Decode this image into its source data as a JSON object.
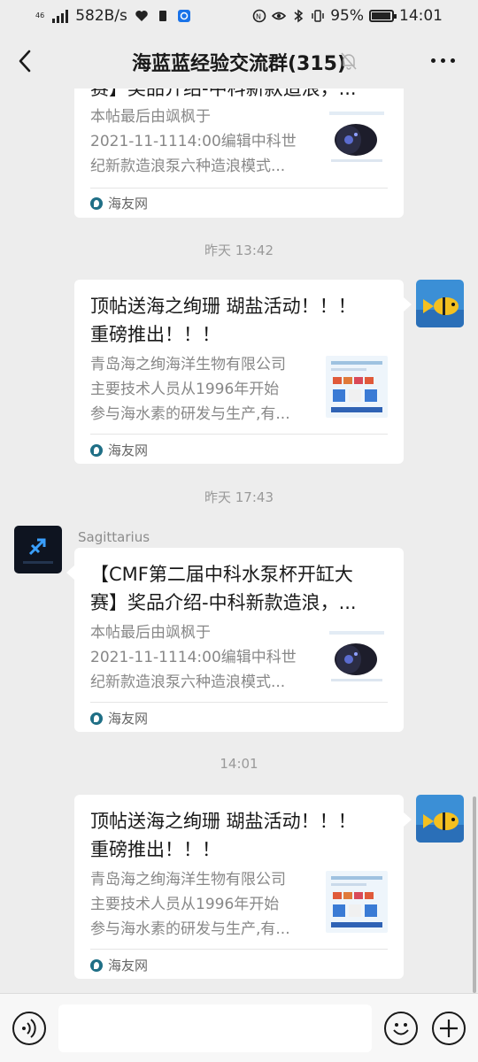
{
  "status_bar": {
    "network_top": "46",
    "network_bottom": "ıll",
    "speed": "582B/s",
    "battery": "95%",
    "battery_level": 0.95,
    "time": "14:01"
  },
  "header": {
    "title": "海蓝蓝经验交流群(315)"
  },
  "messages": [
    {
      "title": "赛】奖品介绍-中科新款造浪，...",
      "desc": [
        "本帖最后由飒枫于",
        "2021-11-1114:00编辑中科世",
        "纪新款造浪泵六种造浪模式..."
      ],
      "source": "海友网"
    },
    {
      "time": "昨天 13:42",
      "title_lines": [
        "顶帖送海之绚珊 瑚盐活动！！！",
        "重磅推出！！！"
      ],
      "desc": [
        "青岛海之绚海洋生物有限公司",
        "主要技术人员从1996年开始",
        "参与海水素的研发与生产,有..."
      ],
      "source": "海友网"
    },
    {
      "time": "昨天 17:43",
      "sender": "Sagittarius",
      "title_lines": [
        "【CMF第二届中科水泵杯开缸大",
        "赛】奖品介绍-中科新款造浪，..."
      ],
      "desc": [
        "本帖最后由飒枫于",
        "2021-11-1114:00编辑中科世",
        "纪新款造浪泵六种造浪模式..."
      ],
      "source": "海友网"
    },
    {
      "time": "14:01",
      "title_lines": [
        "顶帖送海之绚珊 瑚盐活动！！！",
        "重磅推出！！！"
      ],
      "desc": [
        "青岛海之绚海洋生物有限公司",
        "主要技术人员从1996年开始",
        "参与海水素的研发与生产,有..."
      ],
      "source": "海友网"
    }
  ],
  "colors": {
    "background": "#ededed",
    "card": "#ffffff",
    "secondary_text": "#888888"
  }
}
